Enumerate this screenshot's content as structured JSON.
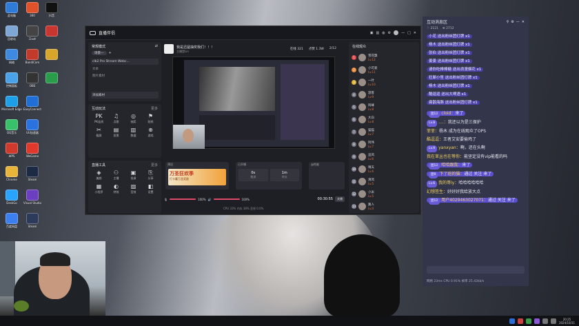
{
  "desktop": {
    "icons": [
      {
        "label": "此电脑",
        "color": "#2f7bd8"
      },
      {
        "label": "回收站",
        "color": "#7fa7d6"
      },
      {
        "label": "网络",
        "color": "#3d8ae0"
      },
      {
        "label": "控制面板",
        "color": "#4aa2e8"
      },
      {
        "label": "Microsoft Edge",
        "color": "#1ea0e8"
      },
      {
        "label": "QQ音乐",
        "color": "#38c06a"
      },
      {
        "label": "WPS",
        "color": "#d0392b"
      },
      {
        "label": "Chrome",
        "color": "#e8b53a"
      },
      {
        "label": "DeskGo",
        "color": "#2aa3ff"
      },
      {
        "label": "百度网盘",
        "color": "#3b7ff0"
      },
      {
        "label": "360",
        "color": "#e0522a"
      },
      {
        "label": "Clash",
        "color": "#444"
      },
      {
        "label": "BandiCam",
        "color": "#c23a2a"
      },
      {
        "label": "OBS",
        "color": "#333"
      },
      {
        "label": "EasyConnect",
        "color": "#1f6fd6"
      },
      {
        "label": "UU加速器",
        "color": "#2a72e0"
      },
      {
        "label": "WeGame",
        "color": "#e0392b"
      },
      {
        "label": "Steam",
        "color": "#1c2a44"
      },
      {
        "label": "Visual Studio",
        "color": "#6b3fc0"
      },
      {
        "label": "Steam",
        "color": "#2b3b59"
      }
    ],
    "right_icons": [
      {
        "label": "抖音",
        "color": "#111"
      },
      {
        "label": "",
        "color": "#c9352f"
      },
      {
        "label": "",
        "color": "#d8a62b"
      },
      {
        "label": "",
        "color": "#2a9d4b"
      }
    ]
  },
  "studio": {
    "title": "直播伴侣",
    "scene_title": "常规模式",
    "scene_tab": "场景一",
    "scene_item": "clb2 Pro Stream Webc...",
    "text_item": "文本",
    "image_item": "图片素材",
    "add_source": "添加素材",
    "interact_title": "互动玩法",
    "interact_more": "更多",
    "interact_items": [
      {
        "g": "PK",
        "l": "PK连线"
      },
      {
        "g": "♫",
        "l": "点歌"
      },
      {
        "g": "◎",
        "l": "抽奖"
      },
      {
        "g": "⚑",
        "l": "贴纸"
      },
      {
        "g": "✂",
        "l": "截屏"
      },
      {
        "g": "▤",
        "l": "投票"
      },
      {
        "g": "▥",
        "l": "数据"
      },
      {
        "g": "⊕",
        "l": "游戏"
      }
    ],
    "tools_title": "直播工具",
    "tools_more": "更多",
    "tools_items": [
      {
        "g": "◈",
        "l": "美颜"
      },
      {
        "g": "⚇",
        "l": "主播"
      },
      {
        "g": "▣",
        "l": "投屏"
      },
      {
        "g": "⎘",
        "l": "分享"
      },
      {
        "g": "▦",
        "l": "小程序"
      },
      {
        "g": "◐",
        "l": "特效"
      },
      {
        "g": "▨",
        "l": "音效"
      },
      {
        "g": "◧",
        "l": "设置"
      }
    ],
    "stream_title": "我是迅猛抽奖我们！！！",
    "stream_sub": "主播是Lin",
    "stats": [
      {
        "k": "在线",
        "v": "321"
      },
      {
        "k": "点赞",
        "v": "1.3W"
      },
      {
        "k": "",
        "v": "2/12"
      }
    ],
    "banner_title": "万圣狂欢季",
    "banner_sub": "打卡赢万圣奖励",
    "preset_label": "预设",
    "interact_panel_label": "已开播",
    "perf_label": "@性能",
    "timer": "00:30:55",
    "end_button": "关播",
    "vol1": "100%",
    "vol2": "100%",
    "stat_box": [
      {
        "k": "0s",
        "v": "推流"
      },
      {
        "k": "1m",
        "v": "时长"
      }
    ],
    "footer": "CPU 33% 内存 38% 丢帧 0.0%"
  },
  "ranks": {
    "title": "在线观众",
    "items": [
      {
        "n": "1",
        "name": "雪花飘",
        "sub": "Lv.12",
        "c": "#e04b4b"
      },
      {
        "n": "2",
        "name": "小可爱",
        "sub": "Lv.11",
        "c": "#f08c3a"
      },
      {
        "n": "3",
        "name": "一叶",
        "sub": "Lv.10",
        "c": "#e0b43a"
      },
      {
        "n": "4",
        "name": "游客",
        "sub": "Lv.9",
        "c": "#7a7a88"
      },
      {
        "n": "5",
        "name": "阿峰",
        "sub": "Lv.8",
        "c": "#7a7a88"
      },
      {
        "n": "6",
        "name": "大白",
        "sub": "Lv.8",
        "c": "#7a7a88"
      },
      {
        "n": "7",
        "name": "猫猫",
        "sub": "Lv.7",
        "c": "#7a7a88"
      },
      {
        "n": "8",
        "name": "阿伟",
        "sub": "Lv.7",
        "c": "#7a7a88"
      },
      {
        "n": "9",
        "name": "追风",
        "sub": "Lv.6",
        "c": "#7a7a88"
      },
      {
        "n": "10",
        "name": "晴天",
        "sub": "Lv.6",
        "c": "#7a7a88"
      },
      {
        "n": "11",
        "name": "清风",
        "sub": "Lv.5",
        "c": "#7a7a88"
      },
      {
        "n": "12",
        "name": "小米",
        "sub": "Lv.5",
        "c": "#7a7a88"
      },
      {
        "n": "13",
        "name": "路人",
        "sub": "Lv.4",
        "c": "#7a7a88"
      }
    ]
  },
  "chat": {
    "title": "互动消息区",
    "sub1": "♡ 2121",
    "sub2": "⊕ 2712",
    "messages": [
      {
        "t": "小花 送出粉丝团灯牌",
        "x": "x1"
      },
      {
        "t": "杨木 送出粉丝团灯牌",
        "x": "x1"
      },
      {
        "t": "张伯 送出粉丝团灯牌",
        "x": "x1"
      },
      {
        "t": "姜姜 送出粉丝团灯牌",
        "x": "x1"
      },
      {
        "t": "请你吃棒棒糖 送出浪漫烟花",
        "x": "x1"
      },
      {
        "t": "狂犀小笙 送出粉丝团灯牌",
        "x": "x1"
      },
      {
        "t": "杨木 送出粉丝团灯牌",
        "x": "x1"
      },
      {
        "t": "酷逗逗 送出大啤酒",
        "x": "x1"
      },
      {
        "t": "扁鹊海豚 送出粉丝团灯牌",
        "x": "x1"
      }
    ],
    "lines": [
      {
        "b": "团12",
        "n": "cloid",
        "m": "来了",
        "h": true
      },
      {
        "b": "Lv.8",
        "n": "....",
        "m": "我还以为是三保护",
        "h": false
      },
      {
        "b": "",
        "n": "菲菲",
        "m": "杨木 成为在线观众了OPS",
        "h": false
      },
      {
        "b": "",
        "n": "酷逗逗",
        "m": "王者艾安要偷鸡了",
        "h": false
      },
      {
        "b": "Lv.9",
        "n": "yanxyan",
        "m": "啊，还在头啊",
        "h": false
      },
      {
        "b": "",
        "n": "我在草丛也在等你",
        "m": "能坚定没有vip能看的吗",
        "h": false
      },
      {
        "b": "团12",
        "n": "哈哈跟我",
        "m": "来了",
        "h": true
      },
      {
        "b": "团9",
        "n": "下了班的猫",
        "m": "通过 关注 来了",
        "h": true
      },
      {
        "b": "Lv.6",
        "n": "我的哥ly",
        "m": "哈哈哈哈哈哈",
        "h": false
      },
      {
        "b": "",
        "n": "幻想签生",
        "m": "好好好我给放大点",
        "h": false
      },
      {
        "b": "团12",
        "n": "用户4029463027071",
        "m": "通过 关注 来了",
        "h": true
      }
    ],
    "status": "网络 23ms CPU 0.91% 帧率 25.42kb/s"
  },
  "taskbar": {
    "time": "20:25",
    "date": "2024/10/31"
  }
}
